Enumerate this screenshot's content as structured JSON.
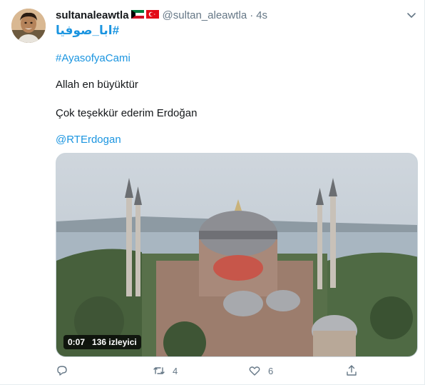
{
  "tweet": {
    "display_name": "sultanaleawtla",
    "handle": "@sultan_aleawtla",
    "separator": "·",
    "time": "4s",
    "lines": [
      "#ابا_صوفيا",
      "#AyasofyaCami",
      "Allah en büyüktür",
      "Çok teşekkür ederim Erdoğan",
      "@RTErdogan"
    ],
    "flags": [
      "kuwait-flag-icon",
      "turkey-flag-icon"
    ]
  },
  "media": {
    "duration": "0:07",
    "views": "136 izleyici"
  },
  "actions": {
    "reply_count": "",
    "retweet_count": "4",
    "like_count": "6"
  },
  "colors": {
    "link": "#1b95e0",
    "secondary": "#657786"
  }
}
